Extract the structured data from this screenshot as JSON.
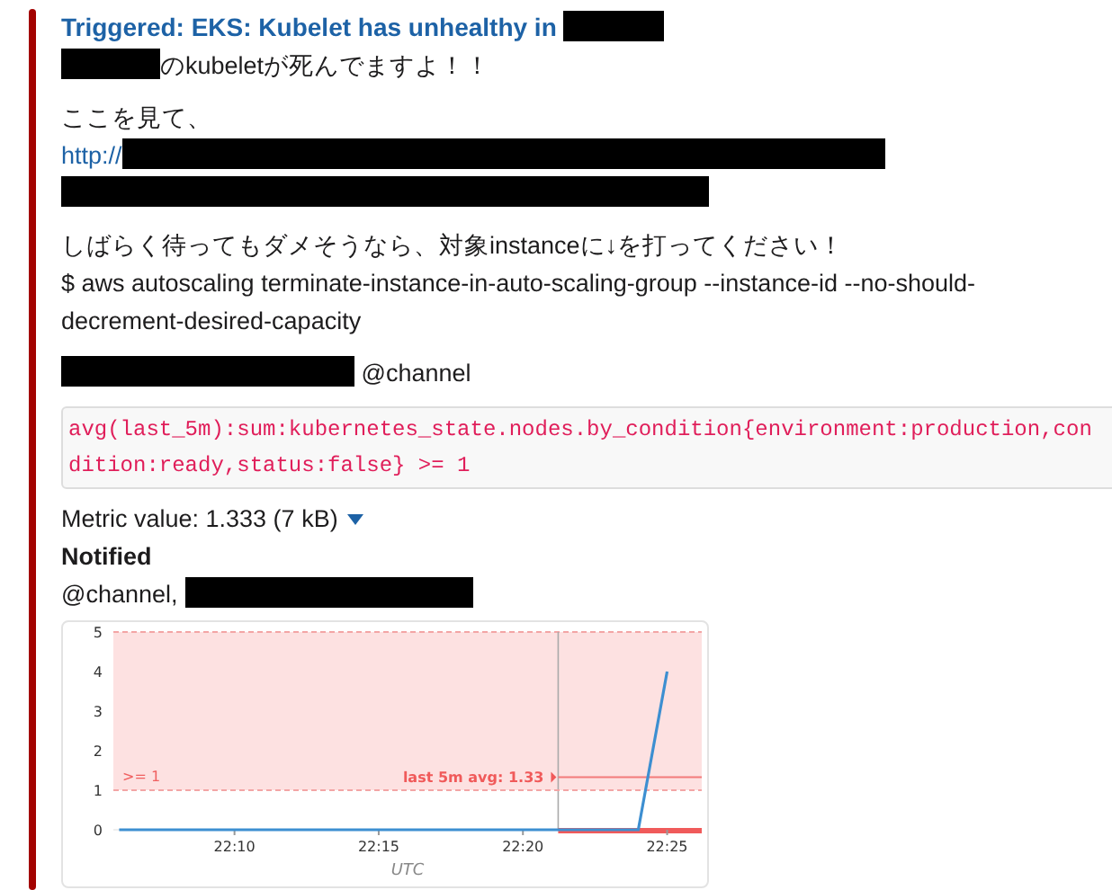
{
  "attachment": {
    "color": "#a30200",
    "title": "Triggered: EKS: Kubelet has unhealthy in ",
    "intro": "のkubeletが死んでますよ！！",
    "look": "ここを見て、",
    "link_prefix": "http://",
    "instruction": "しばらく待ってもダメそうなら、対象instanceに↓を打ってください！",
    "command": "$ aws autoscaling terminate-instance-in-auto-scaling-group --instance-id  --no-should-decrement-desired-capacity",
    "mention": "@channel",
    "query": "avg(last_5m):sum:kubernetes_state.nodes.by_condition{environment:production,condition:ready,status:false} >= 1",
    "metric": "Metric value: 1.333 (7 kB)",
    "notified_heading": "Notified",
    "notified": "@channel, ",
    "chart": {
      "chart_data": {
        "type": "line",
        "xlabel": "UTC",
        "categories": [
          null,
          null,
          null,
          null,
          "22:10",
          null,
          null,
          null,
          null,
          "22:15",
          null,
          null,
          null,
          null,
          "22:20",
          null,
          null,
          null,
          null,
          "22:25",
          null
        ],
        "series": [
          {
            "color": "#3d8fd1",
            "values": [
              0,
              0,
              0,
              0,
              0,
              0,
              0,
              0,
              0,
              0,
              0,
              0,
              0,
              0,
              0,
              0,
              0,
              0,
              0,
              4,
              null
            ]
          }
        ],
        "ylim": [
          0,
          5
        ],
        "yticks": [
          0,
          1,
          2,
          3,
          4,
          5
        ],
        "bands": [
          {
            "axis": "y",
            "from": 1,
            "to": 5
          }
        ],
        "ref_lines": [
          {
            "axis": "y",
            "value": 1.33
          },
          {
            "axis": "y",
            "value": 1
          }
        ],
        "annotations": [
          ">= 1",
          "last 5m avg: 1.33"
        ]
      }
    }
  }
}
